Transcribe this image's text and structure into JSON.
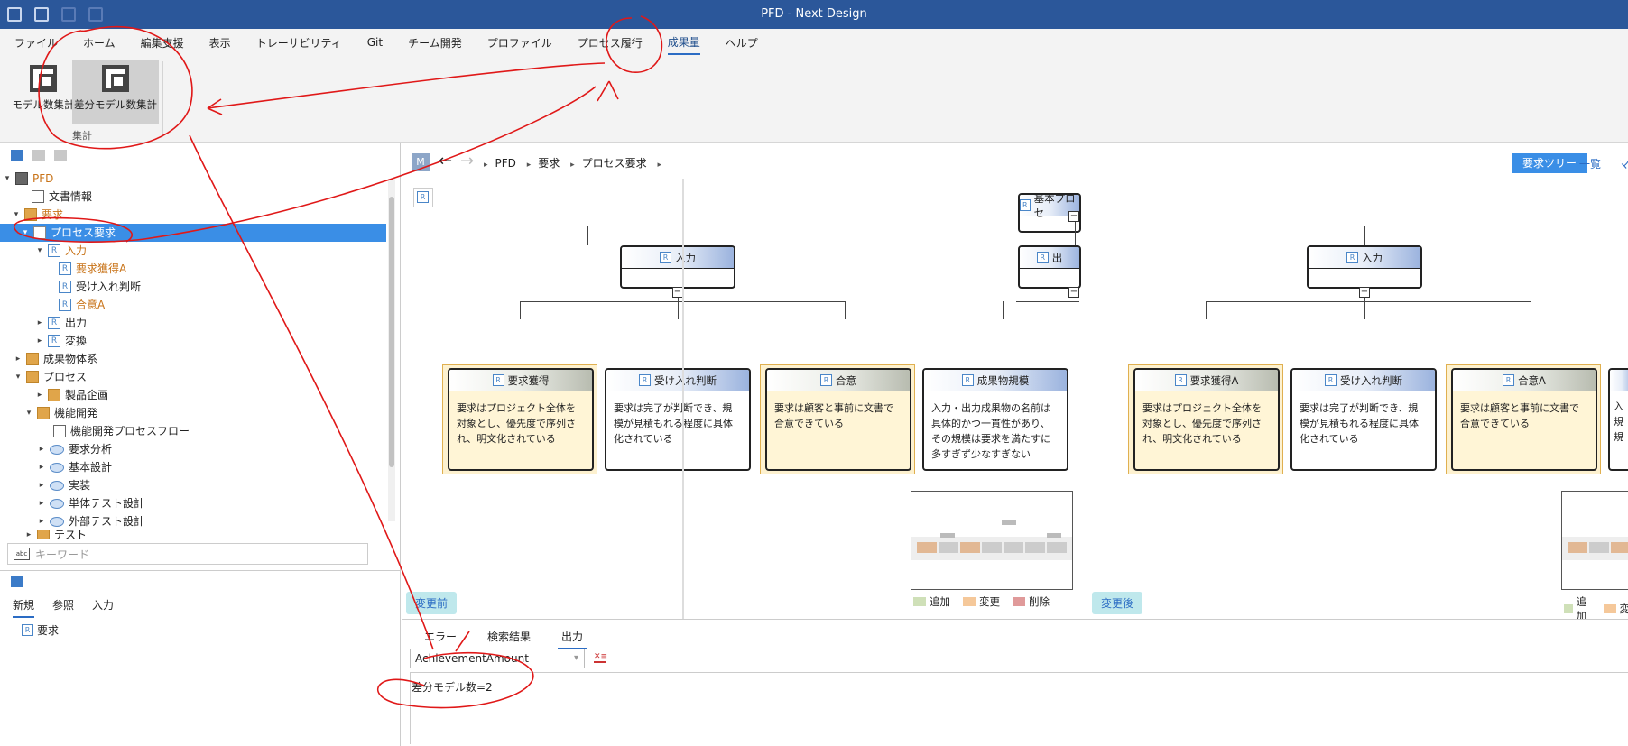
{
  "window": {
    "title": "PFD - Next Design"
  },
  "menu": {
    "items": [
      "ファイル",
      "ホーム",
      "編集支援",
      "表示",
      "トレーサビリティ",
      "Git",
      "チーム開発",
      "プロファイル",
      "プロセス履行",
      "成果量",
      "ヘルプ"
    ]
  },
  "ribbon": {
    "btn1": "モデル数集計",
    "btn2": "差分モデル数集計",
    "group": "集計"
  },
  "tree": {
    "n0": "PFD",
    "n1": "文書情報",
    "n2": "要求",
    "n3": "プロセス要求",
    "n4": "入力",
    "n5": "要求獲得A",
    "n6": "受け入れ判断",
    "n7": "合意A",
    "n8": "出力",
    "n9": "変換",
    "n10": "成果物体系",
    "n11": "プロセス",
    "n12": "製品企画",
    "n13": "機能開発",
    "n14": "機能開発プロセスフロー",
    "n15": "要求分析",
    "n16": "基本設計",
    "n17": "実装",
    "n18": "単体テスト設計",
    "n19": "外部テスト設計",
    "n20": "テスト"
  },
  "search": {
    "placeholder": "キーワード"
  },
  "lowerpanel": {
    "tabs": [
      "新規",
      "参照",
      "入力"
    ],
    "item": "要求"
  },
  "breadcrumb": {
    "m": "M",
    "items": [
      "PFD",
      "要求",
      "プロセス要求"
    ]
  },
  "viewbtns": {
    "tree": "要求ツリー",
    "list": "一覧",
    "more": "マ"
  },
  "left": {
    "top": "基本プロセ",
    "input": "入力",
    "output": "出",
    "c1h": "要求獲得",
    "c1b": "要求はプロジェクト全体を対象とし、優先度で序列され、明文化されている",
    "c2h": "受け入れ判断",
    "c2b": "要求は完了が判断でき、規模が見積もれる程度に具体化されている",
    "c3h": "合意",
    "c3b": "要求は顧客と事前に文書で合意できている",
    "c4h": "成果物規模",
    "c4b": "入力・出力成果物の名前は具体的かつ一貫性があり、その規模は要求を満たすに多すぎず少なすぎない",
    "pill": "変更前"
  },
  "right": {
    "input": "入力",
    "c1h": "要求獲得A",
    "c1b": "要求はプロジェクト全体を対象とし、優先度で序列され、明文化されている",
    "c2h": "受け入れ判断",
    "c2b": "要求は完了が判断でき、規模が見積もれる程度に具体化されている",
    "c3h": "合意A",
    "c3b": "要求は顧客と事前に文書で合意できている",
    "c4b": "入規規",
    "pill": "変更後"
  },
  "legend": {
    "add": "追加",
    "change": "変更",
    "del": "削除",
    "add2": "追加",
    "change2": "変"
  },
  "colors": {
    "add": "#cfe0b8",
    "change": "#f5c89a",
    "del": "#e09a9a",
    "accent": "#3a8ee6",
    "ribbon": "#2b579a"
  },
  "bottom": {
    "tabs": [
      "エラー",
      "検索結果",
      "出力"
    ],
    "combo": "AchievementAmount",
    "output": "差分モデル数=2"
  }
}
